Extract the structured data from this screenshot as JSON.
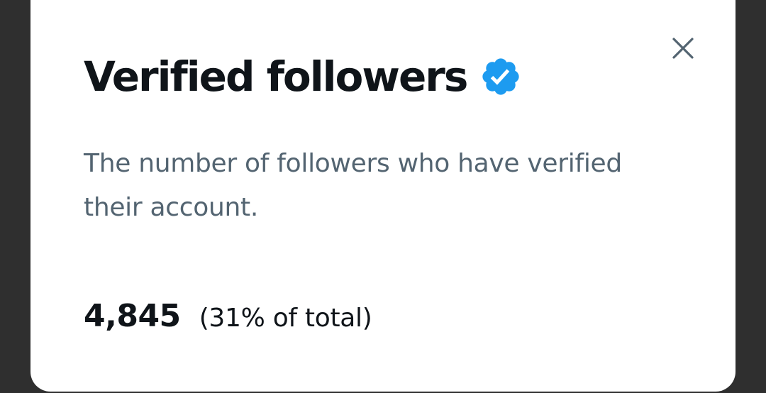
{
  "dialog": {
    "title": "Verified followers",
    "description": "The number of followers who have verified their account.",
    "stat": {
      "value": "4,845",
      "share": "(31% of total)"
    },
    "close_icon": "close-icon",
    "badge_icon": "verified-badge-icon"
  },
  "colors": {
    "backdrop": "#2f2f2f",
    "card": "#ffffff",
    "title": "#0f1419",
    "secondary_text": "#536471",
    "verified_blue": "#1d9bf0"
  }
}
